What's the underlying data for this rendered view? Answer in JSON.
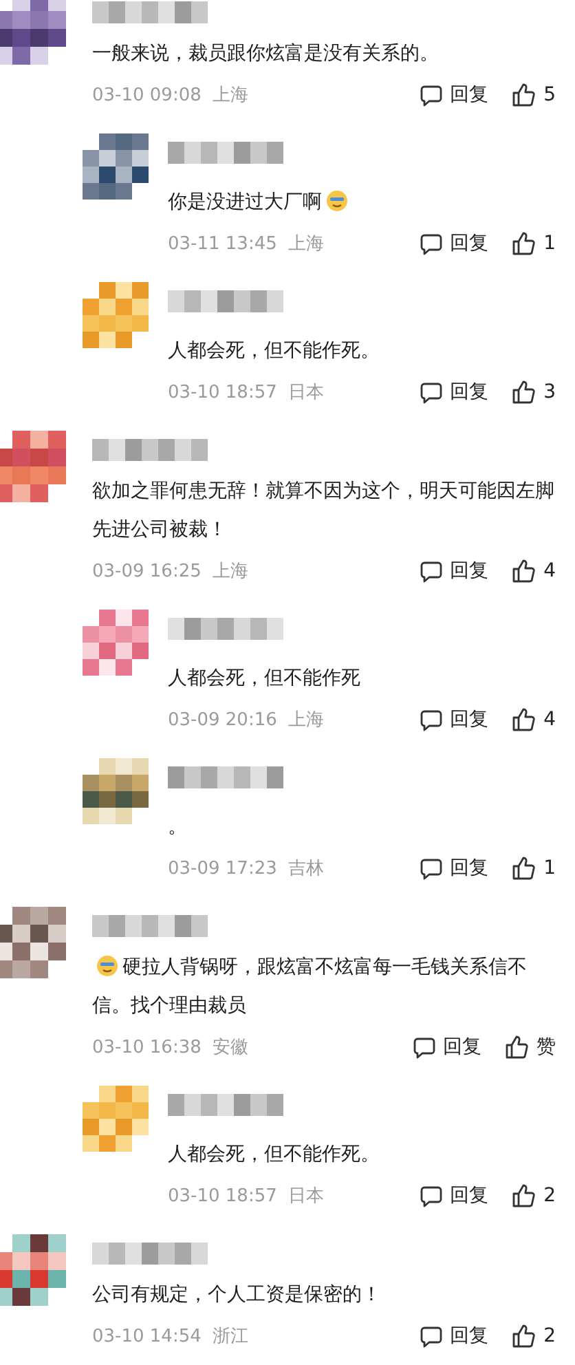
{
  "comments": [
    {
      "kind": "top",
      "text": "一般来说，裁员跟你炫富是没有关系的。",
      "time": "03-10 09:08",
      "location": "上海",
      "reply_label": "回复",
      "likes": "5"
    },
    {
      "kind": "reply",
      "text": "你是没进过大厂啊",
      "emoji_after": true,
      "time": "03-11 13:45",
      "location": "上海",
      "reply_label": "回复",
      "likes": "1"
    },
    {
      "kind": "reply",
      "text": "人都会死，但不能作死。",
      "time": "03-10 18:57",
      "location": "日本",
      "reply_label": "回复",
      "likes": "3"
    },
    {
      "kind": "top",
      "text": "欲加之罪何患无辞！就算不因为这个，明天可能因左脚先进公司被裁！",
      "time": "03-09 16:25",
      "location": "上海",
      "reply_label": "回复",
      "likes": "4"
    },
    {
      "kind": "reply",
      "text": "人都会死，但不能作死",
      "time": "03-09 20:16",
      "location": "上海",
      "reply_label": "回复",
      "likes": "4"
    },
    {
      "kind": "reply",
      "text": "。",
      "time": "03-09 17:23",
      "location": "吉林",
      "reply_label": "回复",
      "likes": "1"
    },
    {
      "kind": "top",
      "text": "硬拉人背锅呀，跟炫富不炫富每一毛钱关系信不信。找个理由裁员",
      "emoji_before": true,
      "time": "03-10 16:38",
      "location": "安徽",
      "reply_label": "回复",
      "likes": "赞"
    },
    {
      "kind": "reply",
      "text": "人都会死，但不能作死。",
      "time": "03-10 18:57",
      "location": "日本",
      "reply_label": "回复",
      "likes": "2"
    },
    {
      "kind": "top",
      "text": "公司有规定，个人工资是保密的！",
      "time": "03-10 14:54",
      "location": "浙江",
      "reply_label": "回复",
      "likes": "2"
    }
  ]
}
